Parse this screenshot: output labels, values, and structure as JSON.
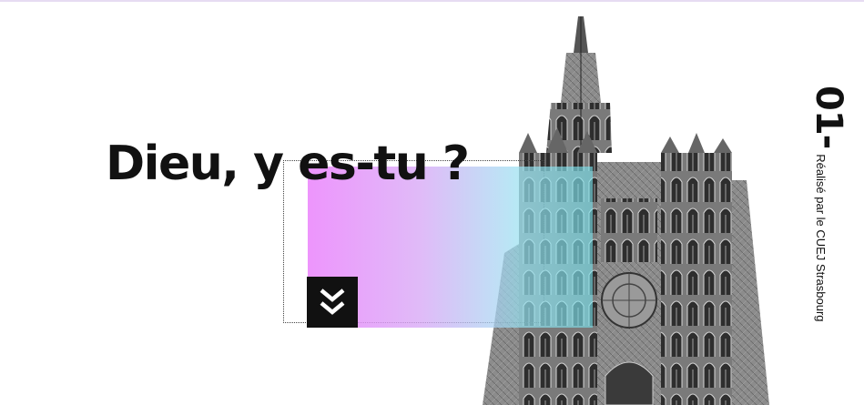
{
  "hero": {
    "title": "Dieu, y es-tu ?",
    "chapter_number": "01-",
    "credit": "Réalisé par le CUEJ Strasbourg"
  },
  "scroll_button": {
    "icon": "double-chevron-down-icon"
  },
  "colors": {
    "gradient_start": "#eb86fc",
    "gradient_end": "#78e2ec",
    "button_bg": "#111111",
    "text": "#111111"
  }
}
